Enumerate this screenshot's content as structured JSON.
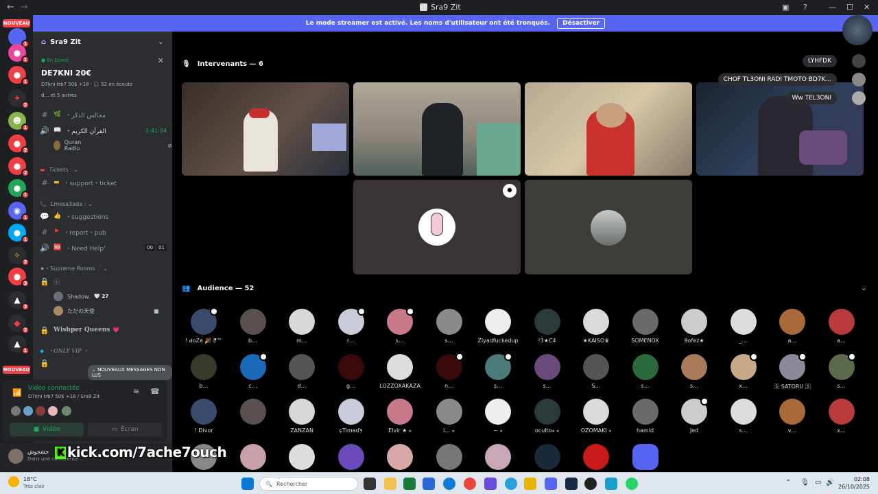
{
  "window": {
    "title": "Sra9 Zit"
  },
  "banner": {
    "text": "Le mode streamer est activé. Les noms d'utilisateur ont été tronqués.",
    "button": "Désactiver"
  },
  "rail": {
    "nouveau_top": "NOUVEAU",
    "nouveau_bottom": "NOUVEAU",
    "badges": [
      "1",
      "1",
      "1",
      "2",
      "1",
      "2",
      "2",
      "1",
      "1",
      "1",
      "2",
      "3",
      "3",
      "2",
      "1"
    ]
  },
  "sidebar": {
    "server_name": "Sra9 Zit",
    "live_label": "En Direct",
    "live_title": "DE7KNI 20€",
    "live_line1": "D7kni trb7 50$ +18 · 🎧 52 en écoute",
    "live_line2": "d… et 5 autres",
    "ch_majalis": "・مجالس الذكر",
    "ch_quran": "・القرآن الكريم",
    "ch_quran_time": "1:41:04",
    "quran_radio": "Quran Radio",
    "cat_tickets": "Tickets : ⌄",
    "ch_support": "・support・ticket",
    "cat_lmosa3ada": "Lmosa3ada : ⌄",
    "ch_suggestions": "・suggestions",
    "ch_report": "・report・pub",
    "ch_needhelp": "・Need Help'",
    "needhelp_count1": "00",
    "needhelp_count2": "01",
    "cat_supreme": "★・Supreme Rooms .˙ ⌄",
    "ch_lock1": "ⓢ",
    "user_shadow": "Shadow.",
    "shadow_badge": "🤍 27",
    "user_tadano": "ただの天使",
    "ch_wishper": "Wishper Queens 💗",
    "cat_onlyvip": "・ONLY VIP ・",
    "unread_popup": "⌄ NOUVEAUX MESSAGES NON LUS"
  },
  "voice_panel": {
    "status": "Vidéo connectée",
    "sub": "D7kni trb7 50$ +18 / Sra9 Zit",
    "video_btn": "Vidéo",
    "screen_btn": "Écran"
  },
  "user": {
    "name": "حشحوش",
    "status": "Dans une conférence"
  },
  "overlay_text": "kick.com/7ache7ouch",
  "stage": {
    "speakers_title": "Intervenants — 6",
    "audience_title": "Audience — 52",
    "pills": [
      "LYHFDK",
      "CHOF TL3ONI RADI TMOTO BD7K...",
      "Ww TEL3ONI"
    ]
  },
  "audience": [
    [
      "! ᑯᴏᏃᴙ 🎉 ⁋™",
      "b…",
      "m…",
      "r…",
      "s…",
      "s…",
      "Ziyadfuckedup",
      "!3★C4",
      "★KAISO♛",
      "SOMENOX",
      "9ofez★",
      "_…",
      "a…",
      "a…"
    ],
    [
      "b…",
      "c…",
      "d…",
      "g…",
      "LOZZOXAKAZA",
      "n…",
      "s…",
      "s…",
      "S…",
      "s…",
      "s…",
      "x…",
      "🅂 SATORU 🅂",
      "s…"
    ],
    [
      "! Divor",
      "",
      "ZANZAN",
      "ɕTimaɗ٩",
      "Elvir ★ ⁎",
      "i… ⁎",
      "~ ⁎",
      "oculto⁎ ⁎",
      "OZOMAKI ⁎",
      "hamid",
      "Jed",
      "s…",
      "v…",
      "x…"
    ]
  ],
  "taskbar": {
    "weather_temp": "18°C",
    "weather_desc": "Très clair",
    "search": "Rechercher",
    "time": "02:08",
    "date": "26/10/2025"
  },
  "colors": {
    "accent": "#5865f2",
    "online": "#23a55a",
    "danger": "#f23f43"
  }
}
